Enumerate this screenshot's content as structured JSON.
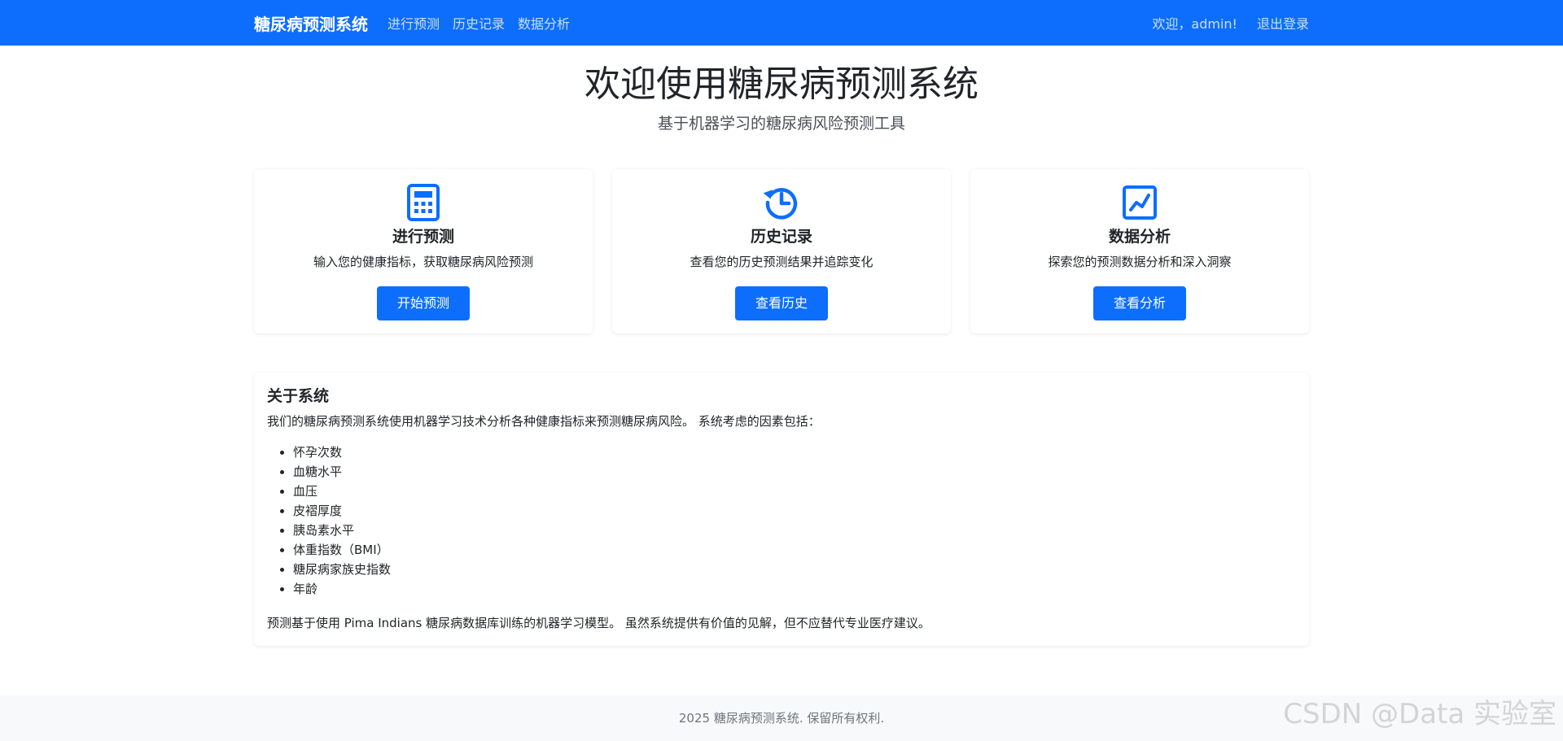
{
  "navbar": {
    "brand": "糖尿病预测系统",
    "links": [
      "进行预测",
      "历史记录",
      "数据分析"
    ],
    "welcome": "欢迎，admin!",
    "logout": "退出登录"
  },
  "hero": {
    "title": "欢迎使用糖尿病预测系统",
    "subtitle": "基于机器学习的糖尿病风险预测工具"
  },
  "cards": [
    {
      "icon": "calculator-icon",
      "title": "进行预测",
      "description": "输入您的健康指标，获取糖尿病风险预测",
      "button": "开始预测"
    },
    {
      "icon": "history-icon",
      "title": "历史记录",
      "description": "查看您的历史预测结果并追踪变化",
      "button": "查看历史"
    },
    {
      "icon": "graph-icon",
      "title": "数据分析",
      "description": "探索您的预测数据分析和深入洞察",
      "button": "查看分析"
    }
  ],
  "about": {
    "title": "关于系统",
    "intro": "我们的糖尿病预测系统使用机器学习技术分析各种健康指标来预测糖尿病风险。 系统考虑的因素包括：",
    "factors": [
      "怀孕次数",
      "血糖水平",
      "血压",
      "皮褶厚度",
      "胰岛素水平",
      "体重指数（BMI）",
      "糖尿病家族史指数",
      "年龄"
    ],
    "footer": "预测基于使用 Pima Indians 糖尿病数据库训练的机器学习模型。 虽然系统提供有价值的见解，但不应替代专业医疗建议。"
  },
  "footer": {
    "copyright": "2025 糖尿病预测系统. 保留所有权利."
  },
  "watermark": "CSDN @Data 实验室",
  "colors": {
    "primary": "#0d6efd",
    "footer_bg": "#f8f9fa"
  }
}
